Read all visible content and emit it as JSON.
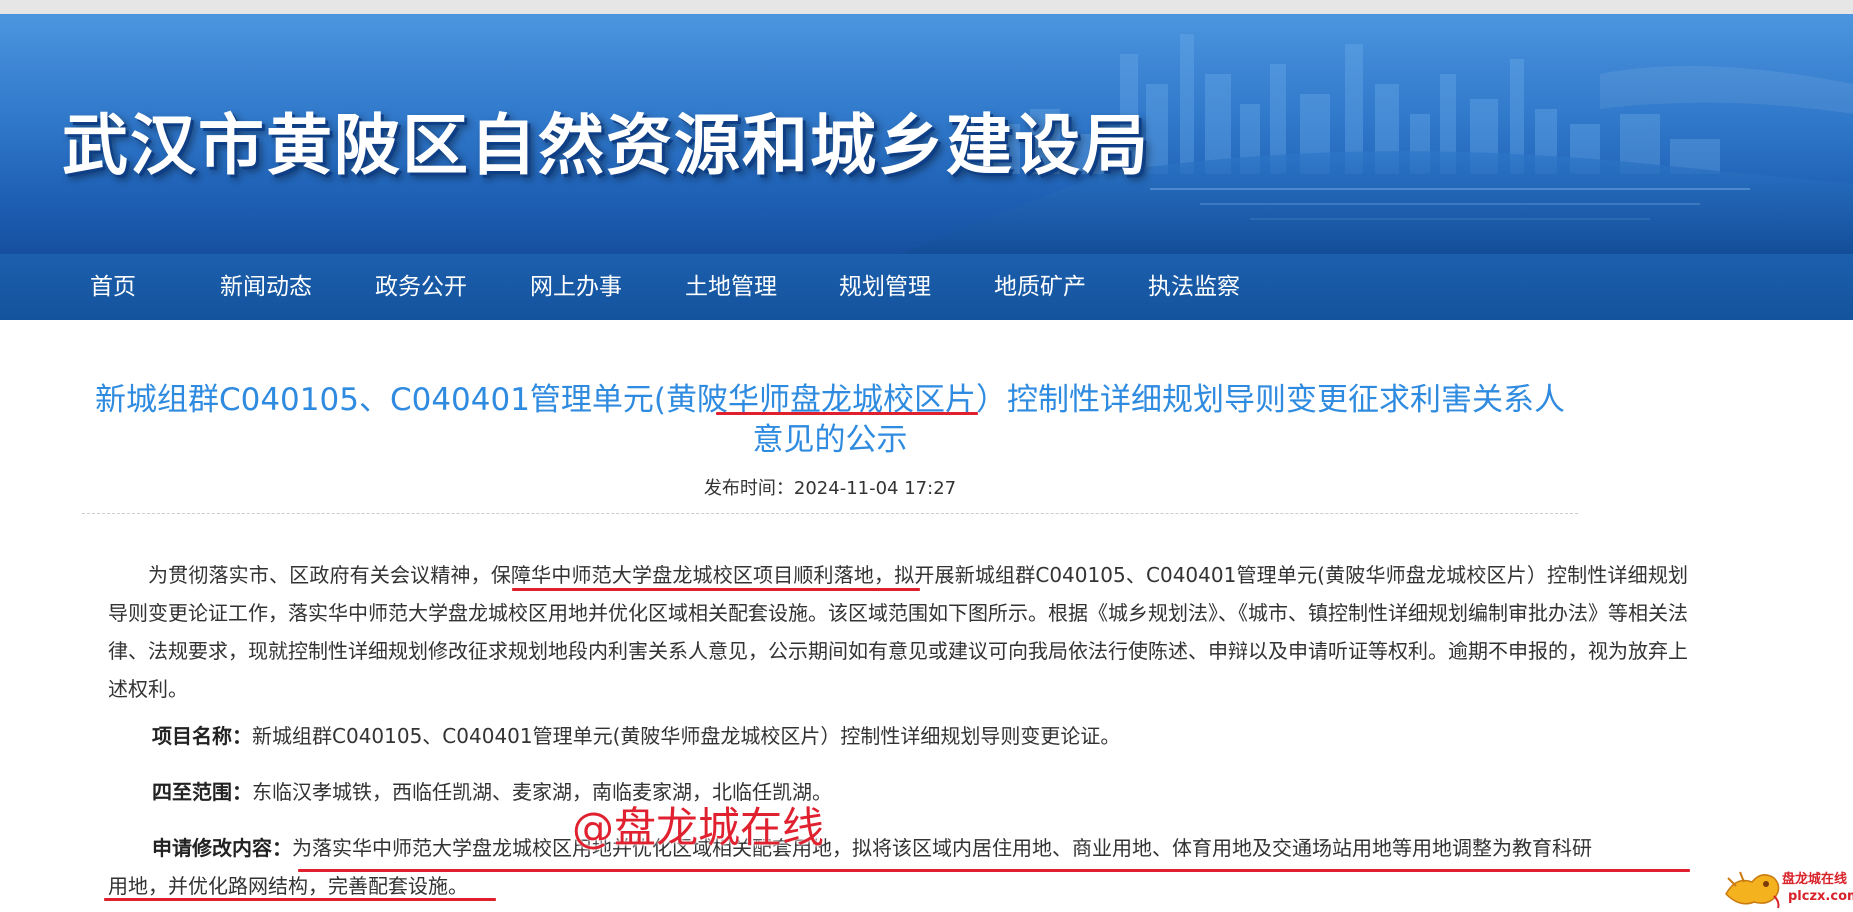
{
  "banner": {
    "title": "武汉市黄陂区自然资源和城乡建设局"
  },
  "nav": {
    "items": [
      {
        "label": "首页"
      },
      {
        "label": "新闻动态"
      },
      {
        "label": "政务公开"
      },
      {
        "label": "网上办事"
      },
      {
        "label": "土地管理"
      },
      {
        "label": "规划管理"
      },
      {
        "label": "地质矿产"
      },
      {
        "label": "执法监察"
      }
    ]
  },
  "article": {
    "title_line1": "新城组群C040105、C040401管理单元(黄陂华师盘龙城校区片）控制性详细规划导则变更征求利害关系人",
    "title_line2": "意见的公示",
    "publish_label": "发布时间：",
    "publish_time": "2024-11-04 17:27",
    "paragraph": "为贯彻落实市、区政府有关会议精神，保障华中师范大学盘龙城校区项目顺利落地，拟开展新城组群C040105、C040401管理单元(黄陂华师盘龙城校区片）控制性详细规划导则变更论证工作，落实华中师范大学盘龙城校区用地并优化区域相关配套设施。该区域范围如下图所示。根据《城乡规划法》、《城市、镇控制性详细规划编制审批办法》等相关法律、法规要求，现就控制性详细规划修改征求规划地段内利害关系人意见，公示期间如有意见或建议可向我局依法行使陈述、申辩以及申请听证等权利。逾期不申报的，视为放弃上述权利。",
    "items": [
      {
        "label": "项目名称：",
        "value": "新城组群C040105、C040401管理单元(黄陂华师盘龙城校区片）控制性详细规划导则变更论证。"
      },
      {
        "label": "四至范围：",
        "value": "东临汉孝城铁，西临任凯湖、麦家湖，南临麦家湖，北临任凯湖。"
      },
      {
        "label": "申请修改内容：",
        "value": "为落实华中师范大学盘龙城校区用地并优化区域相关配套用地，拟将该区域内居住用地、商业用地、体育用地及交通场站用地等用地调整为教育科研"
      },
      {
        "label": "",
        "value": "用地，并优化路网结构，完善配套设施。"
      }
    ]
  },
  "watermark": "@盘龙城在线",
  "corner_logo": {
    "name": "盘龙城在线",
    "url": "plczx.com"
  },
  "colors": {
    "title_blue": "#2f8be0",
    "nav_blue": "#1a5aa8",
    "mark_red": "#e0202e"
  }
}
